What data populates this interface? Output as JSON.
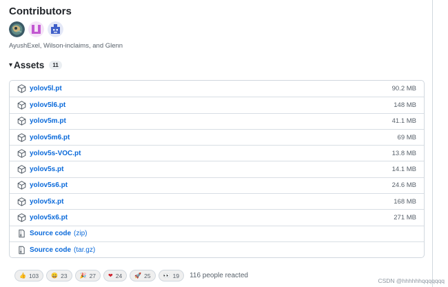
{
  "contributors": {
    "title": "Contributors",
    "avatars": [
      "avatar-ayushexel",
      "avatar-wilson-inclaims",
      "avatar-glenn"
    ],
    "names_text": "AyushExel, Wilson-inclaims, and Glenn"
  },
  "assets": {
    "caret": "▾",
    "title": "Assets",
    "count": "11",
    "items": [
      {
        "name": "yolov5l.pt",
        "size": "90.2 MB",
        "icon": "package-icon"
      },
      {
        "name": "yolov5l6.pt",
        "size": "148 MB",
        "icon": "package-icon"
      },
      {
        "name": "yolov5m.pt",
        "size": "41.1 MB",
        "icon": "package-icon"
      },
      {
        "name": "yolov5m6.pt",
        "size": "69 MB",
        "icon": "package-icon"
      },
      {
        "name": "yolov5s-VOC.pt",
        "size": "13.8 MB",
        "icon": "package-icon"
      },
      {
        "name": "yolov5s.pt",
        "size": "14.1 MB",
        "icon": "package-icon"
      },
      {
        "name": "yolov5s6.pt",
        "size": "24.6 MB",
        "icon": "package-icon"
      },
      {
        "name": "yolov5x.pt",
        "size": "168 MB",
        "icon": "package-icon"
      },
      {
        "name": "yolov5x6.pt",
        "size": "271 MB",
        "icon": "package-icon"
      }
    ],
    "source": [
      {
        "name": "Source code",
        "ext": "(zip)",
        "icon": "file-zip-icon"
      },
      {
        "name": "Source code",
        "ext": "(tar.gz)",
        "icon": "file-zip-icon"
      }
    ]
  },
  "reactions": {
    "items": [
      {
        "emoji": "👍",
        "count": "103"
      },
      {
        "emoji": "😄",
        "count": "23"
      },
      {
        "emoji": "🎉",
        "count": "27"
      },
      {
        "emoji": "❤",
        "count": "24"
      },
      {
        "emoji": "🚀",
        "count": "25"
      },
      {
        "emoji": "👀",
        "count": "19"
      }
    ],
    "summary": "116 people reacted"
  },
  "watermark": "CSDN @hhhhhhqqqqqqq",
  "colors": {
    "link": "#0969da",
    "muted": "#57606a",
    "border": "#d0d7de"
  }
}
